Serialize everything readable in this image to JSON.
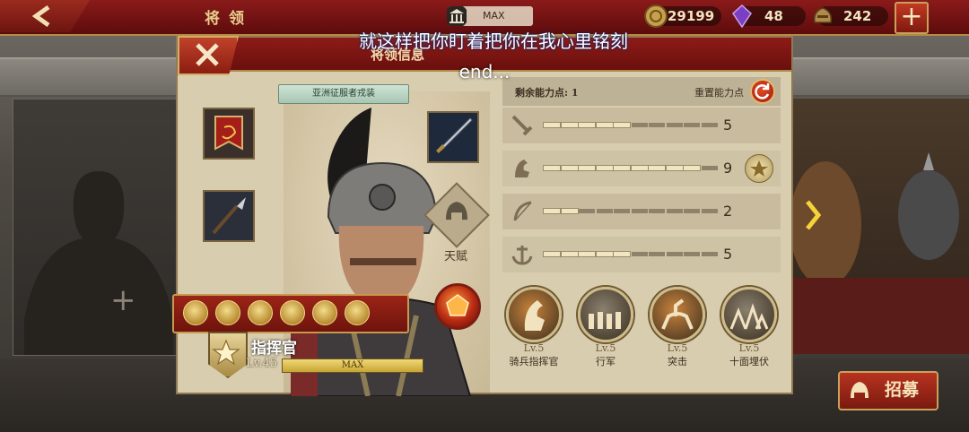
{
  "topbar": {
    "title": "将 领",
    "building_level": "MAX",
    "gold": "29199",
    "gems": "48",
    "medals": "242",
    "plus_label": "+"
  },
  "panel": {
    "title": "将领信息",
    "subtitle": "就这样把你盯着把你在我心里铭刻",
    "subtitle2": "end...",
    "outfit": "亚洲征服者戎装",
    "talent_label": "天赋",
    "commander": {
      "name": "指挥官",
      "level": "Lv.45",
      "exp_label": "MAX"
    },
    "stats": {
      "remaining_label": "剩余能力点: 1",
      "reset_label": "重置能力点",
      "rows": [
        {
          "icon": "sword-icon",
          "value": "5",
          "filled": 5,
          "total": 10
        },
        {
          "icon": "horse-icon",
          "value": "9",
          "filled": 9,
          "total": 10
        },
        {
          "icon": "bow-icon",
          "value": "2",
          "filled": 2,
          "total": 10
        },
        {
          "icon": "anchor-icon",
          "value": "5",
          "filled": 5,
          "total": 10
        }
      ]
    },
    "skills": [
      {
        "level": "Lv.5",
        "name": "骑兵指挥官",
        "color": "#c8823c"
      },
      {
        "level": "Lv.5",
        "name": "行军",
        "color": "#8a8070"
      },
      {
        "level": "Lv.5",
        "name": "突击",
        "color": "#c8823c"
      },
      {
        "level": "Lv.5",
        "name": "十面埋伏",
        "color": "#8a8070"
      }
    ]
  },
  "recruit_label": "招募",
  "colors": {
    "topbar": "#7a1414",
    "panel_bg": "#d9cdb0",
    "accent_gold": "#c9a15a"
  }
}
